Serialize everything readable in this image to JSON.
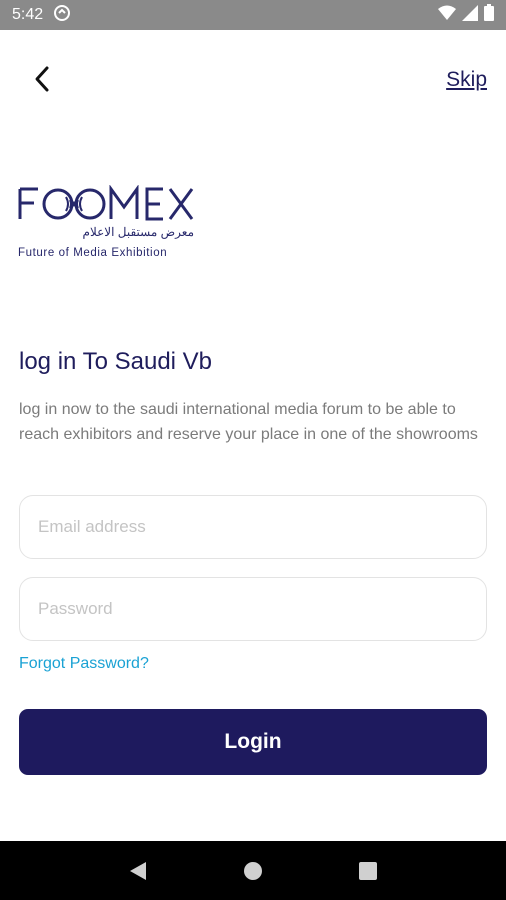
{
  "status_bar": {
    "time": "5:42",
    "icons": [
      "sync-icon",
      "wifi-icon",
      "signal-icon",
      "battery-icon"
    ]
  },
  "header": {
    "back_icon": "back-arrow-icon",
    "skip_label": "Skip"
  },
  "logo": {
    "wordmark": "FOOMEX",
    "arabic": "معرض مستقبل الاعلام",
    "tagline": "Future of Media Exhibition"
  },
  "login": {
    "heading": "log in To Saudi Vb",
    "description": "log in now to the saudi international media forum to be able to reach exhibitors and reserve your place in one of the showrooms",
    "email_placeholder": "Email address",
    "email_value": "",
    "password_placeholder": "Password",
    "password_value": "",
    "forgot_label": "Forgot Password?",
    "login_label": "Login"
  },
  "nav_bar": {
    "back": "nav-back-icon",
    "home": "nav-home-icon",
    "recents": "nav-recents-icon"
  },
  "colors": {
    "primary": "#1e1a5e",
    "link": "#1aa2d4",
    "status_bar": "#8a8a8a"
  }
}
